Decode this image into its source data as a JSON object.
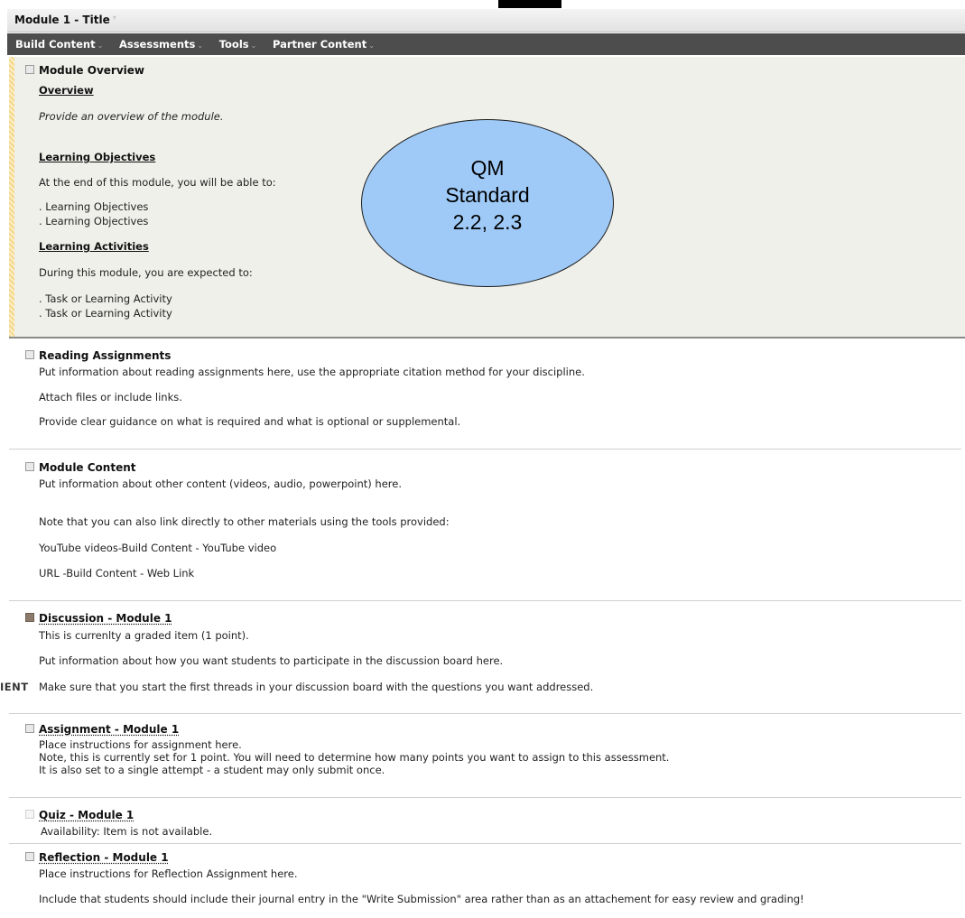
{
  "page": {
    "title": "Module 1 - Title",
    "menu": [
      "Build Content",
      "Assessments",
      "Tools",
      "Partner Content"
    ]
  },
  "overview": {
    "title": "Module Overview",
    "overview_heading": "Overview",
    "overview_text": "Provide an overview of the module.",
    "objectives_heading": "Learning Objectives",
    "objectives_intro": "At the end of this module, you will be able to:",
    "objectives": [
      ". Learning Objectives",
      ". Learning Objectives"
    ],
    "activities_heading": "Learning Activities",
    "activities_intro": "During this module, you are expected to:",
    "activities": [
      ". Task or Learning Activity",
      ". Task or Learning Activity"
    ]
  },
  "callout": {
    "line1": "QM",
    "line2": "Standard",
    "line3": "2.2, 2.3",
    "fill_color": "#9fcaf7"
  },
  "reading": {
    "title": "Reading Assignments",
    "lines": [
      "Put information about reading assignments here, use the appropriate citation method for your discipline.",
      "Attach files or include links.",
      "Provide clear guidance on what is required and what is optional or supplemental."
    ]
  },
  "content": {
    "title": "Module Content",
    "lines": [
      "Put information about other content (videos, audio, powerpoint) here.",
      "Note that you can also link directly to other materials using the tools provided:",
      "YouTube videos-Build Content - YouTube video",
      "URL -Build Content - Web Link"
    ]
  },
  "discussion": {
    "title": "Discussion - Module 1",
    "lines": [
      "This is currenlty a graded item (1 point).",
      "Put information about how you want students to participate in the discussion board here.",
      "Make sure that you start the first threads in your discussion board with the questions you want addressed."
    ],
    "clipped_label": "IENT"
  },
  "assignment": {
    "title": "Assignment - Module 1",
    "lines": [
      "Place instructions for assignment here.",
      "Note, this is currently set for 1 point. You will need to determine how many points you want to assign to this assessment.",
      "It is also set to a single attempt - a student may only submit once."
    ]
  },
  "quiz": {
    "title": "Quiz - Module 1",
    "availability": "Availability: Item is not available."
  },
  "reflection": {
    "title": "Reflection - Module 1",
    "lines": [
      "Place instructions for Reflection Assignment here.",
      "Include that students should include their journal entry in the \"Write Submission\" area rather than as an attachement for easy review and grading!"
    ]
  },
  "icons": {
    "item": "content-item-icon",
    "discussion": "discussion-icon",
    "assignment": "assignment-icon",
    "quiz": "quiz-icon",
    "reflection": "reflection-icon"
  }
}
